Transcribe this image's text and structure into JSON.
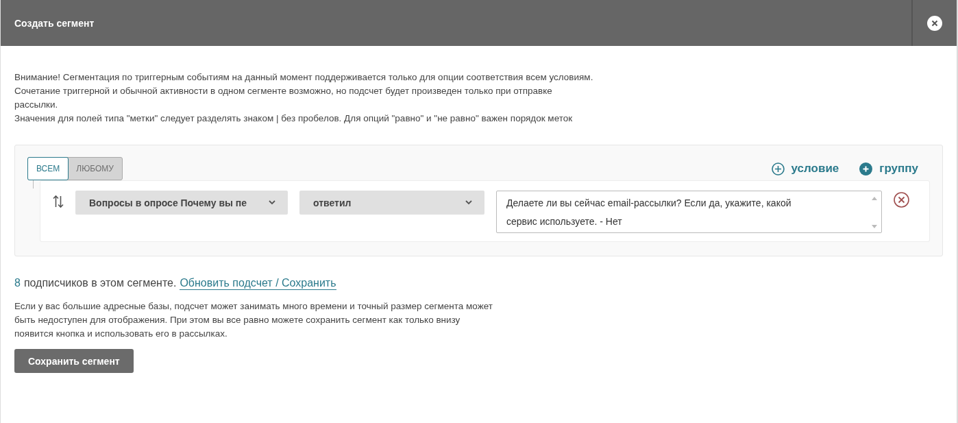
{
  "window": {
    "title": "Создать сегмент"
  },
  "notice": [
    "Внимание! Сегментация по триггерным событиям на данный момент поддерживается только для опции соответствия всем условиям. Сочетание триггерной и обычной активности в одном сегменте возможно, но подсчет будет произведен только при отправке рассылки.",
    "Значения для полей типа \"метки\" следует разделять знаком | без пробелов. Для опций \"равно\" и \"не равно\" важен порядок меток"
  ],
  "match": [
    {
      "label": "ВСЕМ",
      "selected": true
    },
    {
      "label": "ЛЮБОМУ",
      "selected": false
    }
  ],
  "add_buttons": [
    {
      "kind": "outline",
      "label": "условие"
    },
    {
      "kind": "filled",
      "label": "группу"
    }
  ],
  "conditions": [
    {
      "field": "Вопросы в опросе Почему вы пе",
      "operator": "ответил",
      "value": "Делаете ли вы сейчас email-рассылки? Если да, укажите, какой сервис используете. - Нет"
    }
  ],
  "count": {
    "number": "8",
    "text": "подписчиков в этом сегменте.",
    "link": "Обновить подсчет / Сохранить"
  },
  "hint": "Если у вас большие адресные базы, подсчет может занимать много времени и точный размер сегмента может быть недоступен для отображения. При этом вы все равно можете сохранить сегмент как только внизу появится кнопка и использовать его в рассылках.",
  "save_button": "Сохранить сегмент"
}
